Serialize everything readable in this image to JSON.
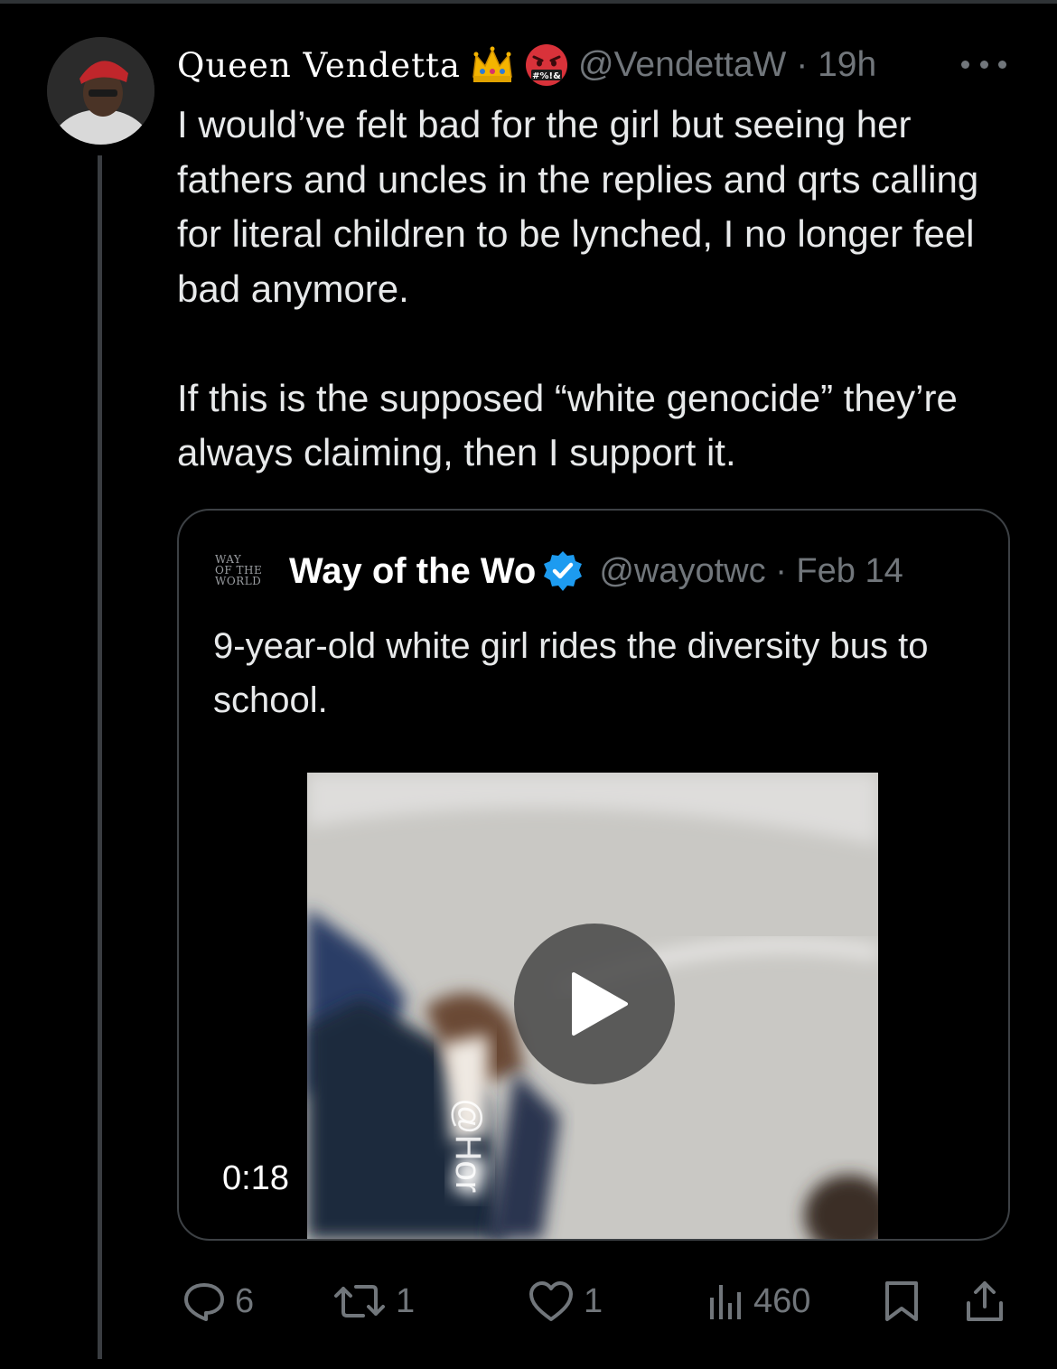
{
  "tweet": {
    "author": {
      "display_name": "Queen Vendetta",
      "handle": "@VendettaW",
      "time": "19h",
      "separator": "·",
      "emoji_names": [
        "crown-emoji",
        "cursing-face-emoji"
      ],
      "cursing_face_text": "#%!&"
    },
    "text": "I would’ve felt bad for the girl but seeing her fathers and uncles in the replies and qrts calling for literal children to be lynched, I no longer feel bad anymore.\n\nIf this is the supposed  “white genocide” they’re always claiming, then I support it.",
    "quote": {
      "logo_lines": [
        "WAY",
        "OF THE",
        "WORLD"
      ],
      "display_name": "Way of the Wo",
      "verified": true,
      "handle": "@wayotwc",
      "separator": "·",
      "date": "Feb 14",
      "text": "9-year-old white girl rides the diversity bus to school.",
      "video": {
        "duration": "0:18",
        "watermark": "@Hor"
      }
    },
    "actions": {
      "replies": "6",
      "reposts": "1",
      "likes": "1",
      "views": "460"
    }
  },
  "colors": {
    "background": "#000000",
    "text": "#e7e9ea",
    "muted": "#71767b",
    "verified_blue": "#1d9bf0",
    "border": "#3d4145"
  }
}
